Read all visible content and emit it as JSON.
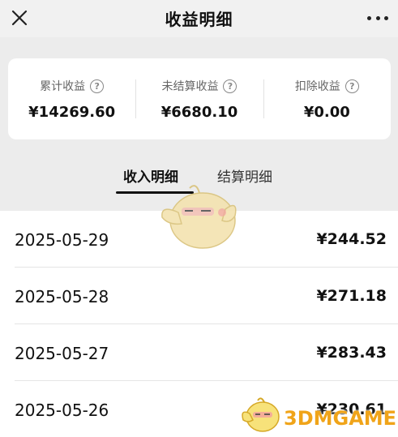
{
  "header": {
    "title": "收益明细",
    "close_icon": "close-icon",
    "more_icon": "more-dots-icon"
  },
  "summary": [
    {
      "label": "累计收益",
      "value": "¥14269.60",
      "help": "?"
    },
    {
      "label": "未结算收益",
      "value": "¥6680.10",
      "help": "?"
    },
    {
      "label": "扣除收益",
      "value": "¥0.00",
      "help": "?"
    }
  ],
  "tabs": [
    {
      "label": "收入明细",
      "active": true
    },
    {
      "label": "结算明细",
      "active": false
    }
  ],
  "records": [
    {
      "date": "2025-05-29",
      "amount": "¥244.52"
    },
    {
      "date": "2025-05-28",
      "amount": "¥271.18"
    },
    {
      "date": "2025-05-27",
      "amount": "¥283.43"
    },
    {
      "date": "2025-05-26",
      "amount": "¥230.61"
    }
  ],
  "watermark": {
    "text": "3DMGAME"
  },
  "colors": {
    "accent": "#111111",
    "background": "#ececec",
    "watermark": "#f0a419"
  }
}
